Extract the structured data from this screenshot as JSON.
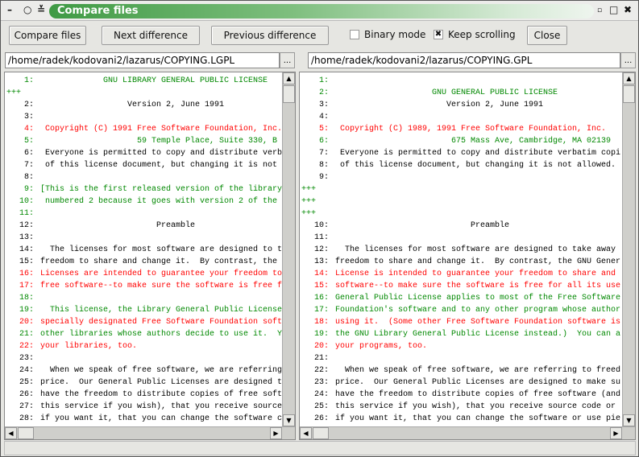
{
  "window": {
    "title": "Compare files"
  },
  "toolbar": {
    "compare": "Compare files",
    "next": "Next difference",
    "previous": "Previous difference",
    "binary_mode": "Binary mode",
    "binary_checked": false,
    "keep_scrolling": "Keep scrolling",
    "keep_checked": true,
    "close": "Close"
  },
  "left": {
    "path": "/home/radek/kodovani2/lazarus/COPYING.LGPL",
    "browse": "...",
    "lines": [
      {
        "n": "1:",
        "t": "             GNU LIBRARY GENERAL PUBLIC LICENSE",
        "c": "green"
      },
      {
        "n": "",
        "t": "+++",
        "c": "green",
        "m": true
      },
      {
        "n": "2:",
        "t": "                  Version 2, June 1991",
        "c": "black"
      },
      {
        "n": "3:",
        "t": "",
        "c": "black"
      },
      {
        "n": "4:",
        "t": " Copyright (C) 1991 Free Software Foundation, Inc.",
        "c": "red"
      },
      {
        "n": "5:",
        "t": "                    59 Temple Place, Suite 330, B",
        "c": "green"
      },
      {
        "n": "6:",
        "t": " Everyone is permitted to copy and distribute verb",
        "c": "black"
      },
      {
        "n": "7:",
        "t": " of this license document, but changing it is not",
        "c": "black"
      },
      {
        "n": "8:",
        "t": "",
        "c": "black"
      },
      {
        "n": "9:",
        "t": "[This is the first released version of the library",
        "c": "green"
      },
      {
        "n": "10:",
        "t": " numbered 2 because it goes with version 2 of the",
        "c": "green"
      },
      {
        "n": "11:",
        "t": "",
        "c": "green"
      },
      {
        "n": "12:",
        "t": "                        Preamble",
        "c": "black"
      },
      {
        "n": "13:",
        "t": "",
        "c": "black"
      },
      {
        "n": "14:",
        "t": "  The licenses for most software are designed to t",
        "c": "black"
      },
      {
        "n": "15:",
        "t": "freedom to share and change it.  By contrast, the",
        "c": "black"
      },
      {
        "n": "16:",
        "t": "Licenses are intended to guarantee your freedom to",
        "c": "red"
      },
      {
        "n": "17:",
        "t": "free software--to make sure the software is free f",
        "c": "red"
      },
      {
        "n": "18:",
        "t": "",
        "c": "green"
      },
      {
        "n": "19:",
        "t": "  This license, the Library General Public License",
        "c": "green"
      },
      {
        "n": "20:",
        "t": "specially designated Free Software Foundation soft",
        "c": "red"
      },
      {
        "n": "21:",
        "t": "other libraries whose authors decide to use it.  Y",
        "c": "green"
      },
      {
        "n": "22:",
        "t": "your libraries, too.",
        "c": "red"
      },
      {
        "n": "23:",
        "t": "",
        "c": "black"
      },
      {
        "n": "24:",
        "t": "  When we speak of free software, we are referring",
        "c": "black"
      },
      {
        "n": "25:",
        "t": "price.  Our General Public Licenses are designed t",
        "c": "black"
      },
      {
        "n": "26:",
        "t": "have the freedom to distribute copies of free soft",
        "c": "black"
      },
      {
        "n": "27:",
        "t": "this service if you wish), that you receive source",
        "c": "black"
      },
      {
        "n": "28:",
        "t": "if you want it, that you can change the software c",
        "c": "black"
      }
    ]
  },
  "right": {
    "path": "/home/radek/kodovani2/lazarus/COPYING.GPL",
    "browse": "...",
    "lines": [
      {
        "n": "1:",
        "t": "",
        "c": "green"
      },
      {
        "n": "2:",
        "t": "                    GNU GENERAL PUBLIC LICENSE",
        "c": "green"
      },
      {
        "n": "3:",
        "t": "                       Version 2, June 1991",
        "c": "black"
      },
      {
        "n": "4:",
        "t": "",
        "c": "black"
      },
      {
        "n": "5:",
        "t": " Copyright (C) 1989, 1991 Free Software Foundation, Inc.",
        "c": "red"
      },
      {
        "n": "6:",
        "t": "                        675 Mass Ave, Cambridge, MA 02139",
        "c": "green"
      },
      {
        "n": "7:",
        "t": " Everyone is permitted to copy and distribute verbatim copi",
        "c": "black"
      },
      {
        "n": "8:",
        "t": " of this license document, but changing it is not allowed.",
        "c": "black"
      },
      {
        "n": "9:",
        "t": "",
        "c": "black"
      },
      {
        "n": "",
        "t": "+++",
        "c": "green",
        "m": true
      },
      {
        "n": "",
        "t": "+++",
        "c": "green",
        "m": true
      },
      {
        "n": "",
        "t": "+++",
        "c": "green",
        "m": true
      },
      {
        "n": "10:",
        "t": "                            Preamble",
        "c": "black"
      },
      {
        "n": "11:",
        "t": "",
        "c": "black"
      },
      {
        "n": "12:",
        "t": "  The licenses for most software are designed to take away",
        "c": "black"
      },
      {
        "n": "13:",
        "t": "freedom to share and change it.  By contrast, the GNU Gener",
        "c": "black"
      },
      {
        "n": "14:",
        "t": "License is intended to guarantee your freedom to share and",
        "c": "red"
      },
      {
        "n": "15:",
        "t": "software--to make sure the software is free for all its use",
        "c": "red"
      },
      {
        "n": "16:",
        "t": "General Public License applies to most of the Free Software",
        "c": "green"
      },
      {
        "n": "17:",
        "t": "Foundation's software and to any other program whose author",
        "c": "green"
      },
      {
        "n": "18:",
        "t": "using it.  (Some other Free Software Foundation software is",
        "c": "red"
      },
      {
        "n": "19:",
        "t": "the GNU Library General Public License instead.)  You can a",
        "c": "green"
      },
      {
        "n": "20:",
        "t": "your programs, too.",
        "c": "red"
      },
      {
        "n": "21:",
        "t": "",
        "c": "black"
      },
      {
        "n": "22:",
        "t": "  When we speak of free software, we are referring to freed",
        "c": "black"
      },
      {
        "n": "23:",
        "t": "price.  Our General Public Licenses are designed to make su",
        "c": "black"
      },
      {
        "n": "24:",
        "t": "have the freedom to distribute copies of free software (and",
        "c": "black"
      },
      {
        "n": "25:",
        "t": "this service if you wish), that you receive source code or",
        "c": "black"
      },
      {
        "n": "26:",
        "t": "if you want it, that you can change the software or use pie",
        "c": "black"
      }
    ]
  },
  "status": {
    "text": ""
  }
}
